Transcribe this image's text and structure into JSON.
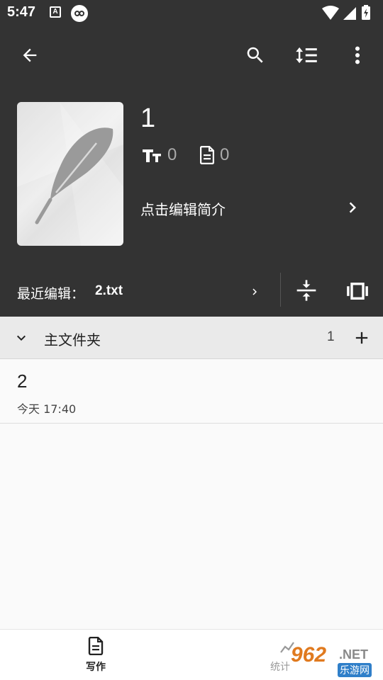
{
  "status_bar": {
    "time": "5:47",
    "keyboard_badge": "A",
    "icons": [
      "wifi-icon",
      "signal-icon",
      "battery-charging-icon"
    ]
  },
  "toolbar": {
    "icons": [
      "back-arrow-icon",
      "search-icon",
      "sort-icon",
      "more-vert-icon"
    ]
  },
  "book": {
    "title": "1",
    "word_count": "0",
    "chapter_count": "0",
    "intro_placeholder": "点击编辑简介"
  },
  "recent": {
    "label": "最近编辑：",
    "file": "2.txt"
  },
  "folder": {
    "name": "主文件夹",
    "count": "1"
  },
  "chapters": [
    {
      "title": "2",
      "time": "今天 17:40"
    }
  ],
  "bottom_nav": {
    "write_label": "写作",
    "stats_label": "统计"
  },
  "watermark": {
    "big": "962",
    "net": ".NET",
    "sub": "乐游网"
  },
  "colors": {
    "header_bg": "#333333",
    "folder_bg": "#eaeaea",
    "watermark_orange": "#e07a1f",
    "watermark_blue": "#2f7fc9"
  }
}
